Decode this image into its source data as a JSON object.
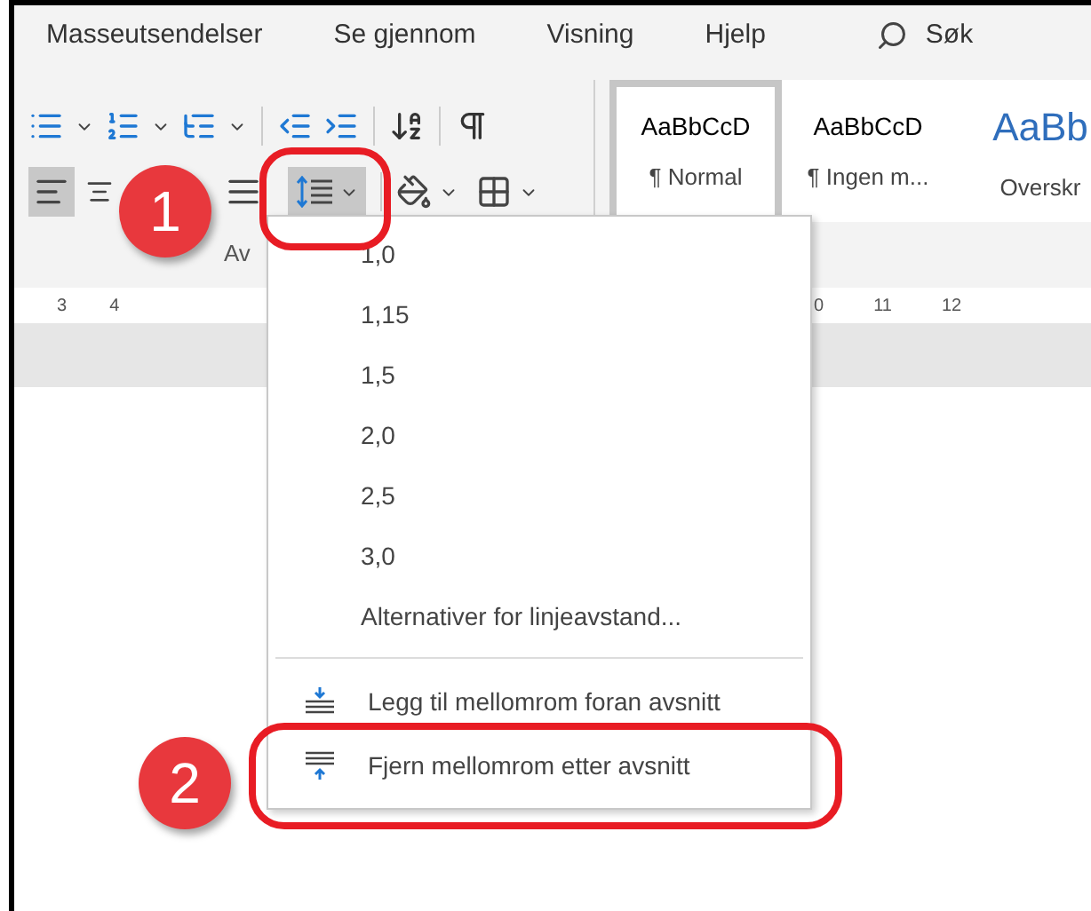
{
  "tabs": [
    {
      "label": "Masseutsendelser"
    },
    {
      "label": "Se gjennom"
    },
    {
      "label": "Visning"
    },
    {
      "label": "Hjelp"
    }
  ],
  "search": {
    "label": "Søk"
  },
  "paragraph_group": {
    "label": "Av",
    "alignments": [
      {
        "kind": "left",
        "selected": true
      },
      {
        "kind": "center",
        "selected": false
      },
      {
        "kind": "justify",
        "selected": false
      }
    ],
    "line_spacing_pressed": true
  },
  "styles": [
    {
      "preview": "AaBbCcD",
      "name": "¶ Normal",
      "selected": true,
      "kind": "body"
    },
    {
      "preview": "AaBbCcD",
      "name": "¶ Ingen m...",
      "selected": false,
      "kind": "body"
    },
    {
      "preview": "AaBb",
      "name": "Overskr",
      "selected": false,
      "kind": "heading"
    }
  ],
  "ruler": {
    "left_marks": [
      "3",
      "4"
    ],
    "right_marks": [
      "0",
      "11",
      "12"
    ]
  },
  "menu": [
    {
      "kind": "value",
      "label": "1,0"
    },
    {
      "kind": "value",
      "label": "1,15"
    },
    {
      "kind": "value",
      "label": "1,5"
    },
    {
      "kind": "value",
      "label": "2,0"
    },
    {
      "kind": "value",
      "label": "2,5"
    },
    {
      "kind": "value",
      "label": "3,0"
    },
    {
      "kind": "value",
      "label": "Alternativer for linjeavstand..."
    },
    {
      "kind": "add_before",
      "label": "Legg til mellomrom foran avsnitt"
    },
    {
      "kind": "remove_after",
      "label": "Fjern mellomrom etter avsnitt"
    }
  ],
  "callouts": [
    {
      "number": "1"
    },
    {
      "number": "2"
    }
  ]
}
